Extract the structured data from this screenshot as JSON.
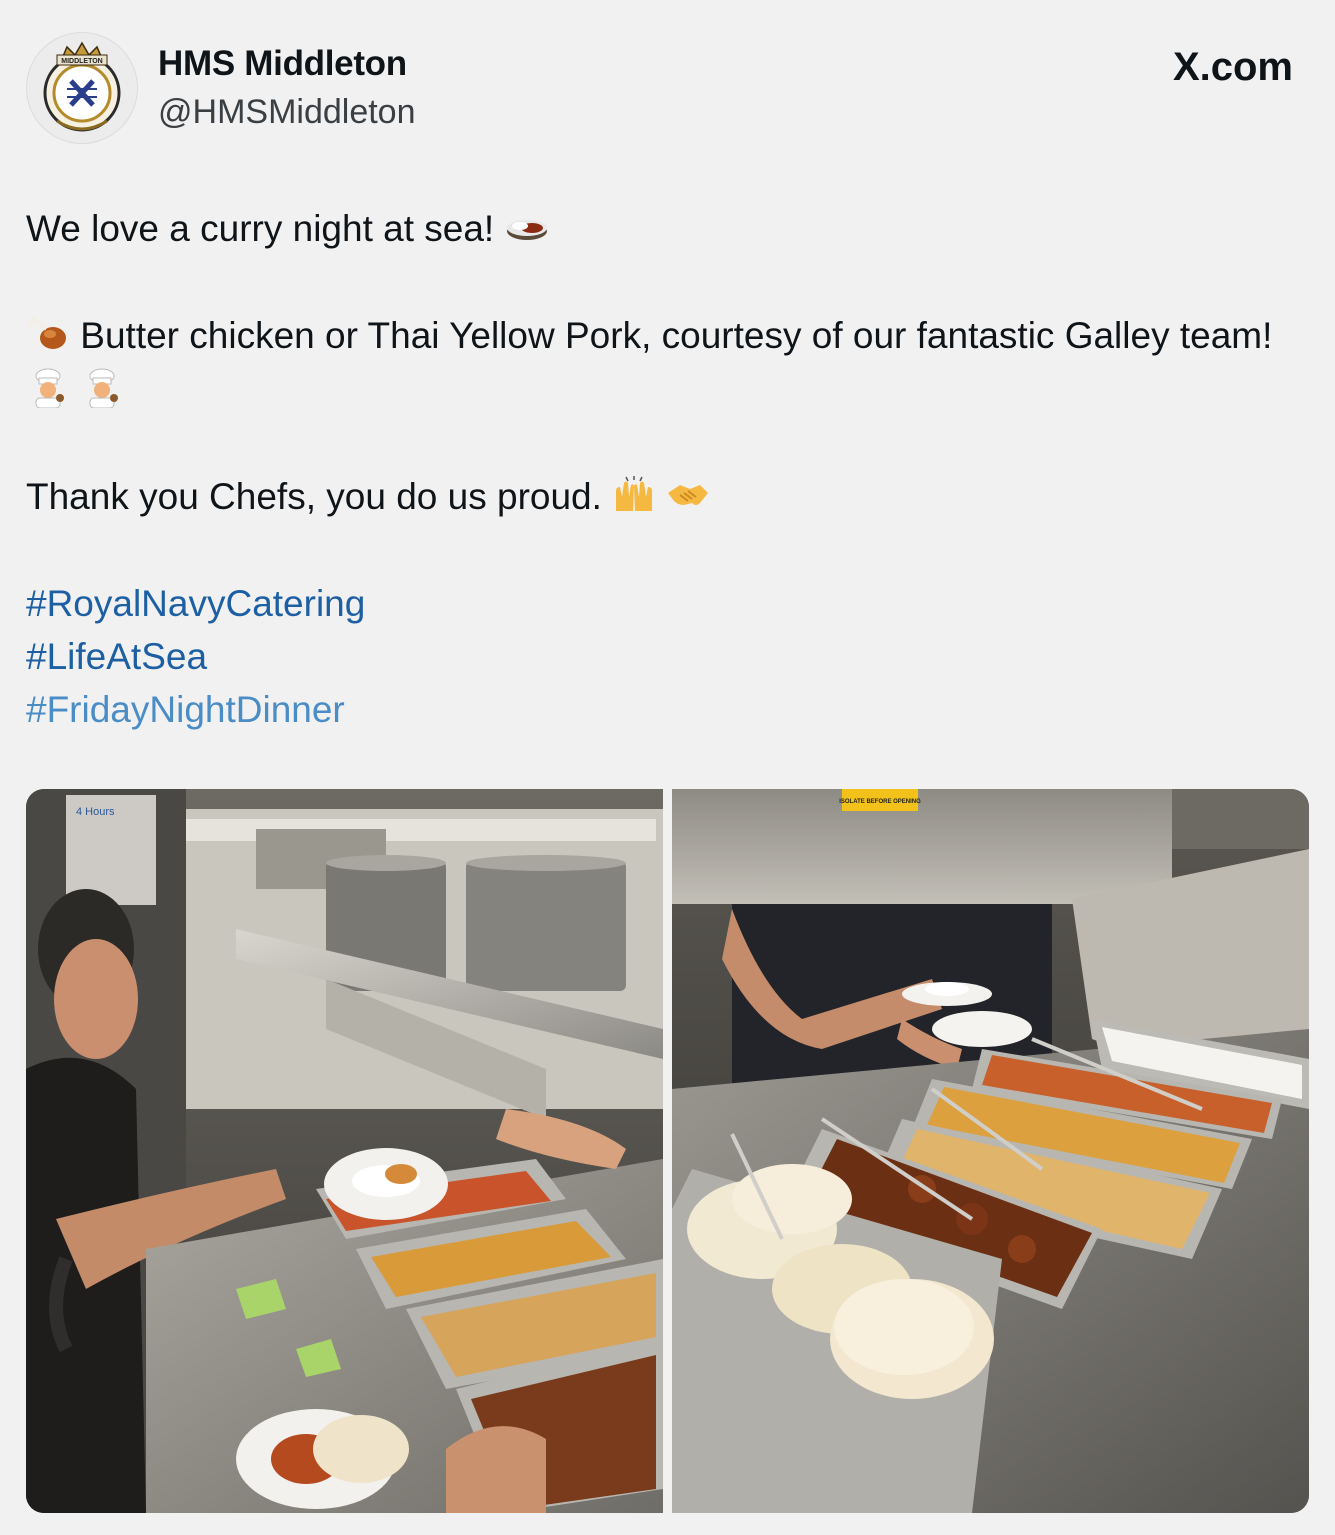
{
  "post": {
    "author": {
      "display_name": "HMS Middleton",
      "handle": "@HMSMiddleton",
      "crest_text": "MIDDLETON"
    },
    "site": "X.com",
    "paragraphs": {
      "line1": "We love a curry night at sea!",
      "line2": "Butter chicken or Thai Yellow Pork, courtesy of our fantastic Galley team!",
      "line3": "Thank you Chefs, you do us proud."
    },
    "emojis": {
      "curry": "curry-rice-icon",
      "drumstick": "poultry-leg-icon",
      "chef": "chef-icon",
      "raised_hands": "raising-hands-icon",
      "handshake": "handshake-icon"
    },
    "hashtags": [
      "#RoyalNavyCatering",
      "#LifeAtSea",
      "#FridayNightDinner"
    ],
    "photos": {
      "left_sign": "4 Hours",
      "right_sign": "ISOLATE BEFORE OPENING"
    }
  },
  "colors": {
    "background": "#f1f1f1",
    "hashtag": "#1d5fa3",
    "hashtag_light": "#4a8cc5",
    "text": "#0f1419"
  }
}
